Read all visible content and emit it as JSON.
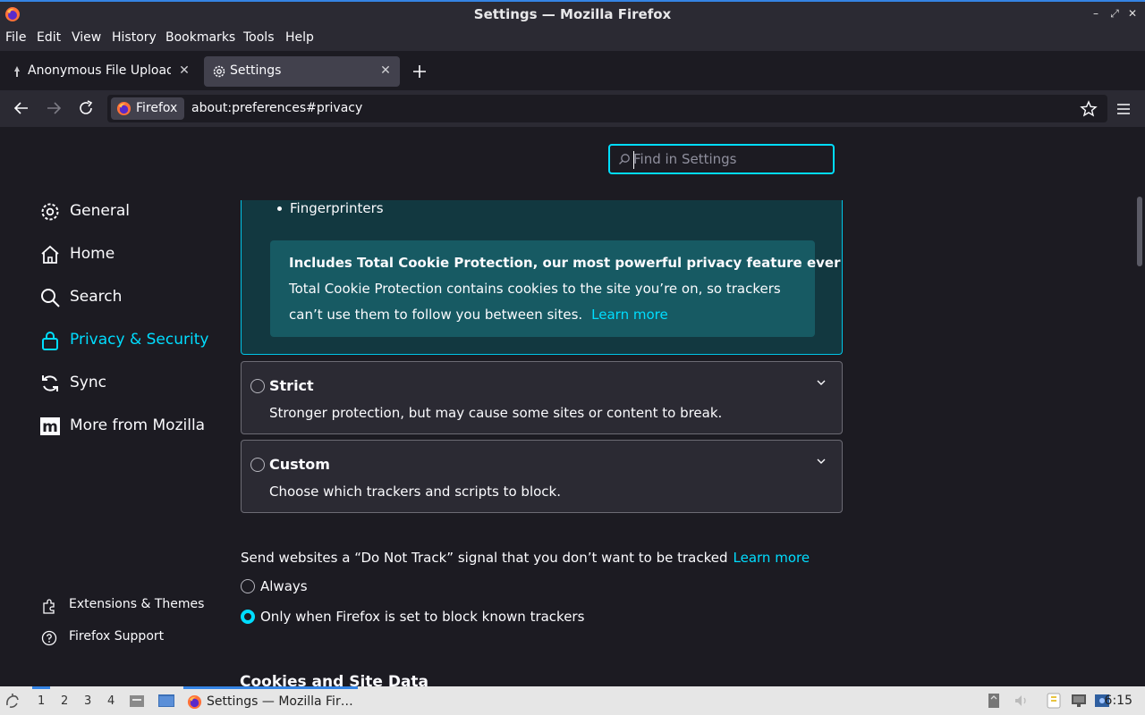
{
  "window": {
    "title": "Settings — Mozilla Firefox"
  },
  "menubar": {
    "items": [
      "File",
      "Edit",
      "View",
      "History",
      "Bookmarks",
      "Tools",
      "Help"
    ]
  },
  "tabs": [
    {
      "label": "Anonymous File Upload - ",
      "active": false
    },
    {
      "label": "Settings",
      "active": true
    }
  ],
  "navbar": {
    "identity_label": "Firefox",
    "url": "about:preferences#privacy"
  },
  "search": {
    "placeholder": "Find in Settings"
  },
  "sidebar": {
    "categories": [
      {
        "label": "General",
        "icon": "gear-icon",
        "selected": false
      },
      {
        "label": "Home",
        "icon": "home-icon",
        "selected": false
      },
      {
        "label": "Search",
        "icon": "search-icon",
        "selected": false
      },
      {
        "label": "Privacy & Security",
        "icon": "lock-icon",
        "selected": true
      },
      {
        "label": "Sync",
        "icon": "sync-icon",
        "selected": false
      },
      {
        "label": "More from Mozilla",
        "icon": "mozilla-icon",
        "selected": false
      }
    ],
    "footer": [
      {
        "label": "Extensions & Themes",
        "icon": "puzzle-icon"
      },
      {
        "label": "Firefox Support",
        "icon": "help-icon"
      }
    ]
  },
  "standard": {
    "bullet": "Fingerprinters",
    "tcp_title": "Includes Total Cookie Protection, our most powerful privacy feature ever",
    "tcp_body_line1": "Total Cookie Protection contains cookies to the site you’re on, so trackers",
    "tcp_body_line2": "can’t use them to follow you between sites.",
    "tcp_link": "Learn more"
  },
  "options": [
    {
      "title": "Strict",
      "description": "Stronger protection, but may cause some sites or content to break."
    },
    {
      "title": "Custom",
      "description": "Choose which trackers and scripts to block."
    }
  ],
  "dnt": {
    "text": "Send websites a “Do Not Track” signal that you don’t want to be tracked",
    "link": "Learn more",
    "choices": [
      {
        "label": "Always",
        "checked": false
      },
      {
        "label": "Only when Firefox is set to block known trackers",
        "checked": true
      }
    ]
  },
  "cookies_heading": "Cookies and Site Data",
  "taskbar": {
    "workspaces": [
      "1",
      "2",
      "3",
      "4"
    ],
    "task_label": "Settings — Mozilla Fir…",
    "clock": "6:15"
  },
  "colors": {
    "accent": "#00ddff",
    "taskbar_highlight": "#3584e4"
  }
}
